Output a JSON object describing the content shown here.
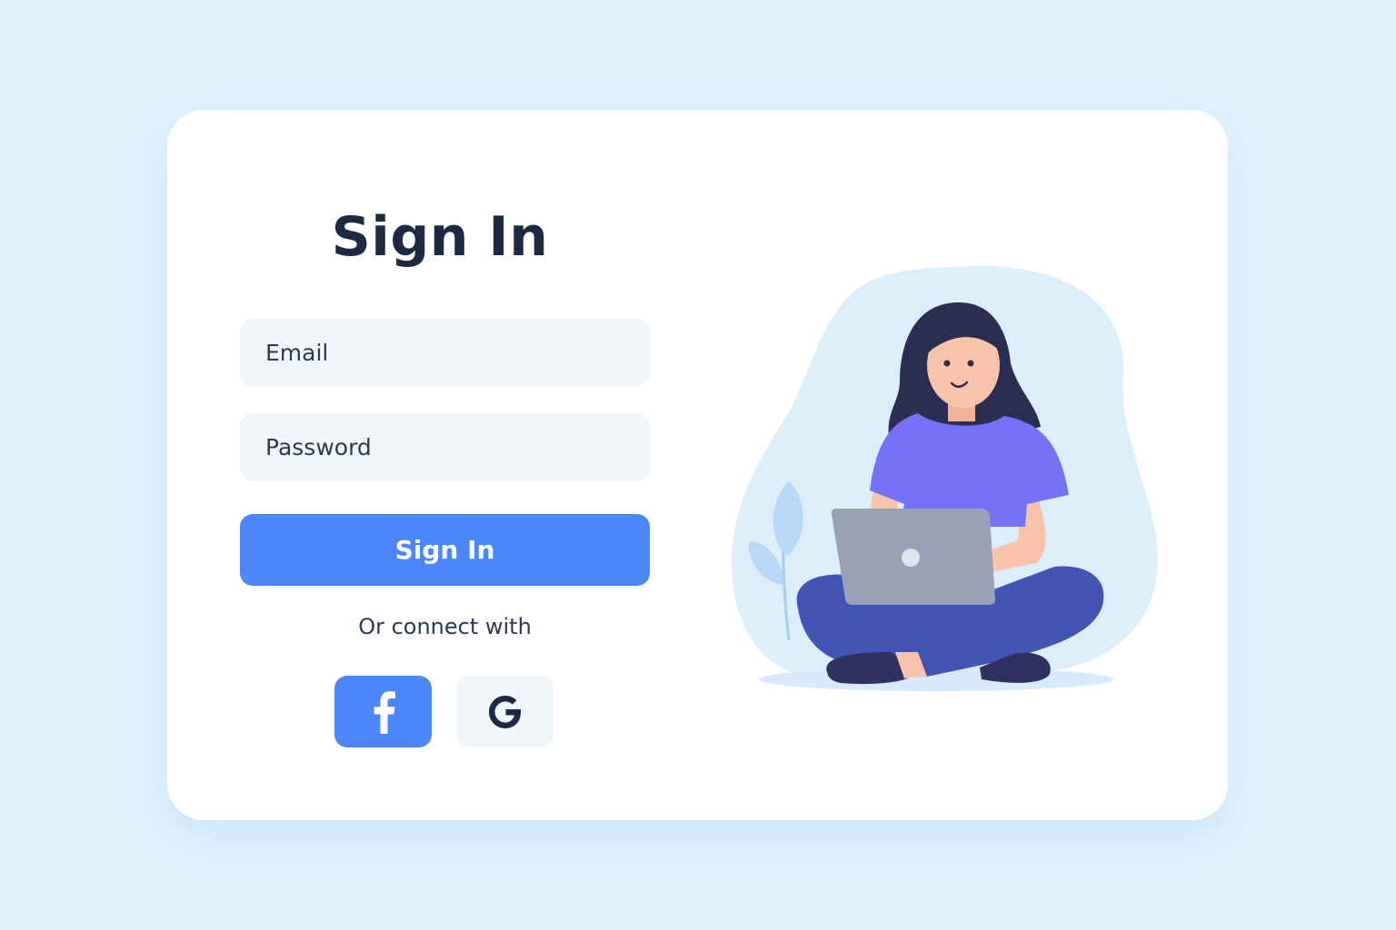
{
  "signin": {
    "title": "Sign In",
    "email_placeholder": "Email",
    "password_placeholder": "Password",
    "submit_label": "Sign In",
    "connect_text": "Or connect with"
  },
  "social": [
    {
      "name": "facebook",
      "icon": "facebook-icon",
      "color": "#4b86fb"
    },
    {
      "name": "google",
      "icon": "google-icon",
      "color": "#1e2a44"
    }
  ],
  "colors": {
    "background": "#dff1fd",
    "card": "#ffffff",
    "accent": "#4b86fb",
    "input_bg": "#f1f6fb",
    "text": "#1e2a44"
  },
  "illustration": {
    "icon": "woman-with-laptop-illustration"
  }
}
